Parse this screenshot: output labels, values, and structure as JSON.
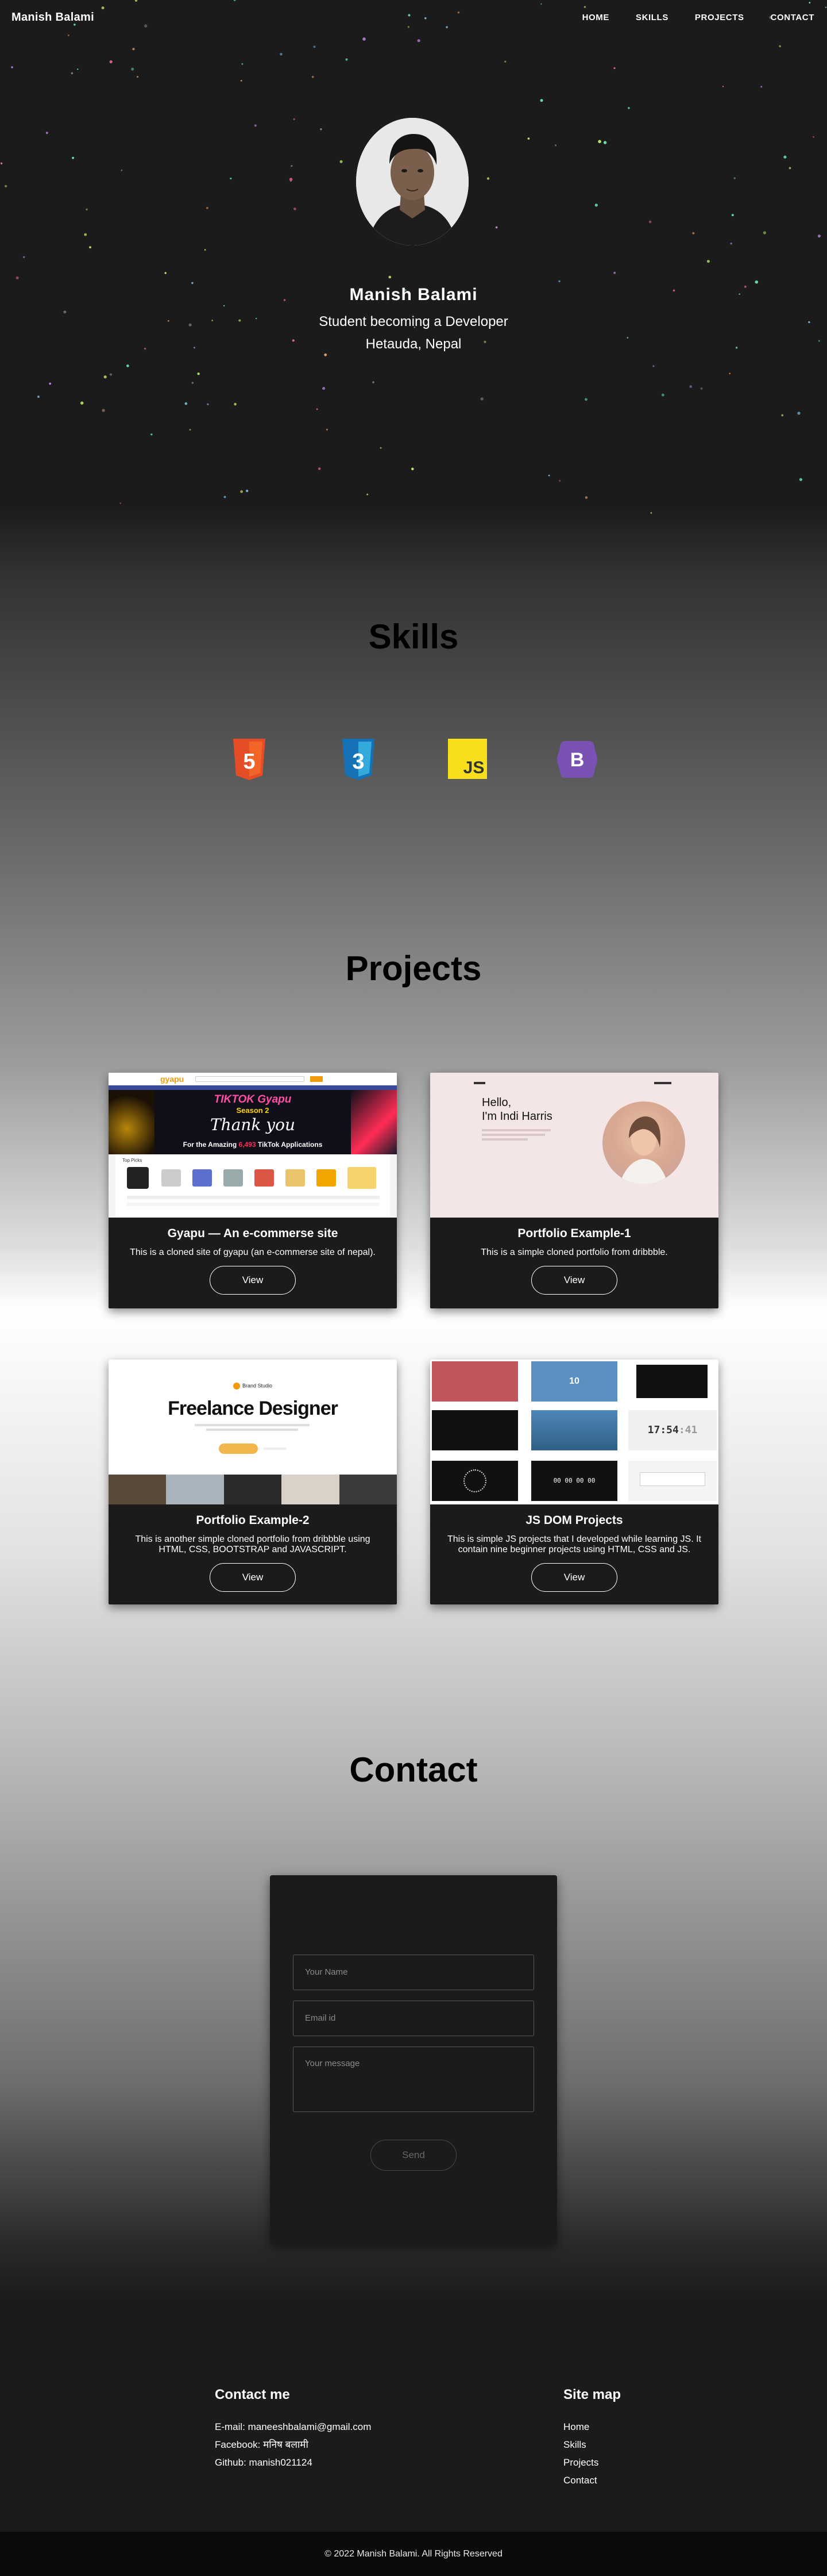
{
  "nav": {
    "brand": "Manish Balami",
    "items": [
      "HOME",
      "SKILLS",
      "PROJECTS",
      "CONTACT"
    ]
  },
  "hero": {
    "name": "Manish Balami",
    "role": "Student becoming a Developer",
    "location": "Hetauda, Nepal"
  },
  "skills": {
    "title": "Skills",
    "icons": [
      {
        "name": "html5-icon",
        "label": "5",
        "color": "#e44d26"
      },
      {
        "name": "css3-icon",
        "label": "3",
        "color": "#1572b6"
      },
      {
        "name": "javascript-icon",
        "label": "JS",
        "color": "#f7df1e"
      },
      {
        "name": "bootstrap-icon",
        "label": "B",
        "color": "#7952b3"
      }
    ]
  },
  "projects": {
    "title": "Projects",
    "view_label": "View",
    "cards": [
      {
        "title": "Gyapu — An e-commerse site",
        "desc": "This is a cloned site of gyapu (an e-commerse site of nepal).",
        "thumb": {
          "logo": "gyapu",
          "banner_top": "TIKTOK Gyapu",
          "banner_sub": "Season 2",
          "banner_thanks": "Thank you",
          "banner_line": "For the Amazing",
          "banner_count": "6,493",
          "banner_end": "TikTok Applications",
          "products_label": "Top Picks"
        }
      },
      {
        "title": "Portfolio Example-1",
        "desc": "This is a simple cloned portfolio from dribbble.",
        "thumb": {
          "greeting": "Hello,",
          "name": "I'm Indi Harris"
        }
      },
      {
        "title": "Portfolio Example-2",
        "desc": "This is another simple cloned portfolio from dribbble using HTML, CSS, BOOTSTRAP and JAVASCRIPT.",
        "thumb": {
          "brand": "Brand Studio",
          "headline": "Freelance Designer"
        }
      },
      {
        "title": "JS DOM Projects",
        "desc": "This is simple JS projects that I developed while learning JS. It contain nine beginner projects using HTML, CSS and JS.",
        "thumb": {
          "counter": "10",
          "clock": "17:54",
          "clock_seconds": ":41",
          "timer": "00 00 00 00"
        }
      }
    ]
  },
  "contact": {
    "title": "Contact",
    "name_placeholder": "Your Name",
    "email_placeholder": "Email id",
    "message_placeholder": "Your message",
    "send_label": "Send"
  },
  "footer": {
    "contact_title": "Contact me",
    "email": "E-mail: maneeshbalami@gmail.com",
    "facebook": "Facebook: मनिष बलामी",
    "github": "Github: manish021124",
    "sitemap_title": "Site map",
    "sitemap": [
      "Home",
      "Skills",
      "Projects",
      "Contact"
    ],
    "copyright": "© 2022 Manish Balami. All Rights Reserved"
  }
}
